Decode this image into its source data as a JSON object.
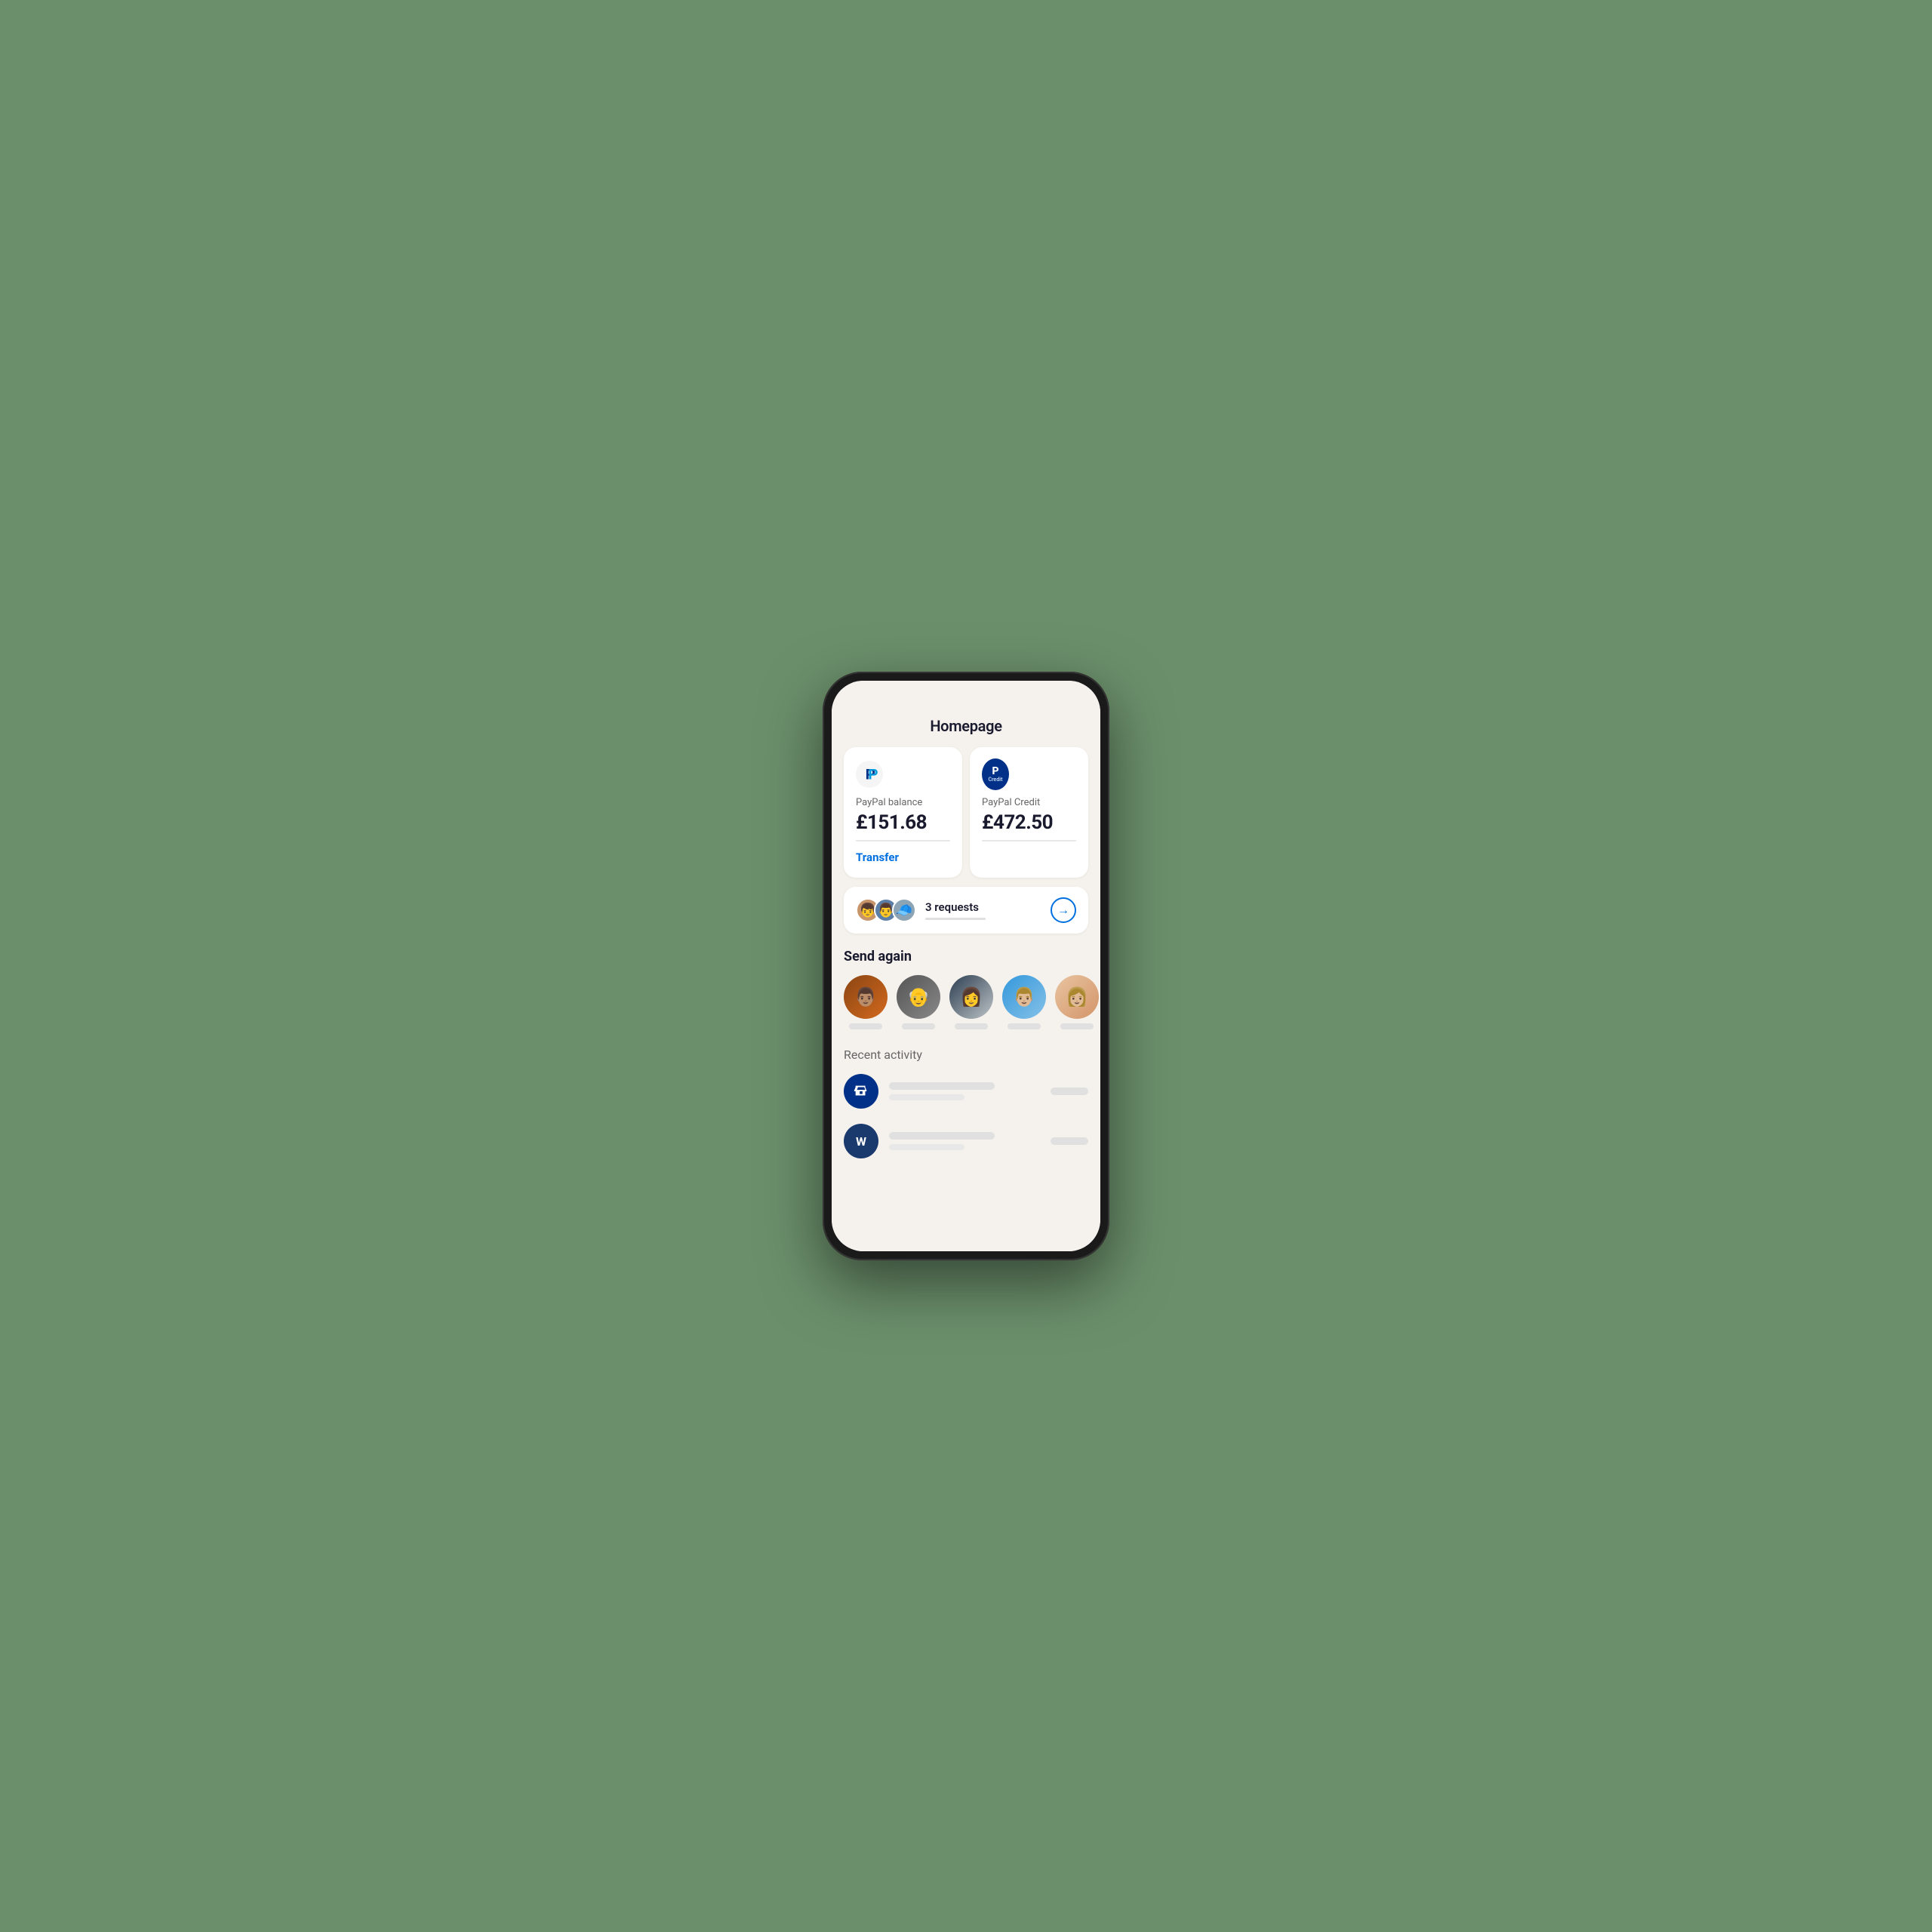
{
  "page": {
    "title": "Homepage",
    "background": "#6b8f6b"
  },
  "balance_card": {
    "label": "PayPal balance",
    "amount": "£151.68",
    "transfer_label": "Transfer"
  },
  "credit_card": {
    "label": "PayPal Credit",
    "amount": "£472.50",
    "icon_p": "P",
    "icon_credit": "Credit"
  },
  "requests": {
    "count_text": "3 requests",
    "arrow": "→"
  },
  "send_again": {
    "section_title": "Send again",
    "contacts": [
      {
        "id": 1,
        "emoji": "👨🏽"
      },
      {
        "id": 2,
        "emoji": "👴🏼"
      },
      {
        "id": 3,
        "emoji": "👩🏻"
      },
      {
        "id": 4,
        "emoji": "👨🏼"
      },
      {
        "id": 5,
        "emoji": "👩🏼"
      }
    ]
  },
  "recent_activity": {
    "section_title": "Recent activity",
    "items": [
      {
        "id": 1,
        "icon": "🏪",
        "type": "store"
      },
      {
        "id": 2,
        "icon": "W",
        "type": "initial"
      }
    ]
  }
}
